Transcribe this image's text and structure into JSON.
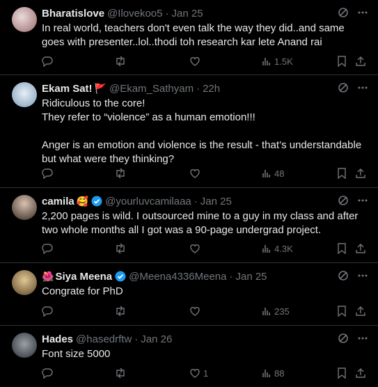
{
  "tweets": [
    {
      "name": "Bharatislove",
      "handle": "@Ilovekoo5",
      "time": "Jan 25",
      "text": "In real world, teachers don't even talk the way they did..and same goes with presenter..lol..thodi toh research kar lete Anand rai",
      "views": "1.5K",
      "likes": "",
      "avatar_color": "#c9a9a6"
    },
    {
      "name": "Ekam Sat!",
      "name_emoji": "🚩",
      "handle": "@Ekam_Sathyam",
      "time": "22h",
      "text": "Ridiculous to the core!\nThey refer to “violence” as a human emotion!!!\n\nAnger is an emotion and violence is the result - that’s understandable but what were they thinking?",
      "views": "48",
      "likes": "",
      "avatar_color": "#8fb3d6"
    },
    {
      "name": "camila",
      "name_emoji": "🥰",
      "verified": true,
      "handle": "@yourluvcamilaaa",
      "time": "Jan 25",
      "text": "2,200 pages is wild. I outsourced mine to a guy in my class and after two whole months all I got was a 90-page undergrad project.",
      "views": "4.3K",
      "likes": "",
      "avatar_color": "#6b4a3a"
    },
    {
      "name": "Siya Meena",
      "name_prefix": "🌺",
      "verified": true,
      "handle": "@Meena4336Meena",
      "time": "Jan 25",
      "text": "Congrate for PhD",
      "views": "235",
      "likes": "",
      "avatar_color": "#a07a4c"
    },
    {
      "name": "Hades",
      "handle": "@hasedrftw",
      "time": "Jan 26",
      "text": "Font size 5000",
      "views": "88",
      "likes": "1",
      "avatar_color": "#4a4f58"
    }
  ],
  "colors": {
    "text": "#e7e9ea",
    "muted": "#71767b",
    "verified": "#1d9bf0",
    "divider": "#2f3336"
  }
}
